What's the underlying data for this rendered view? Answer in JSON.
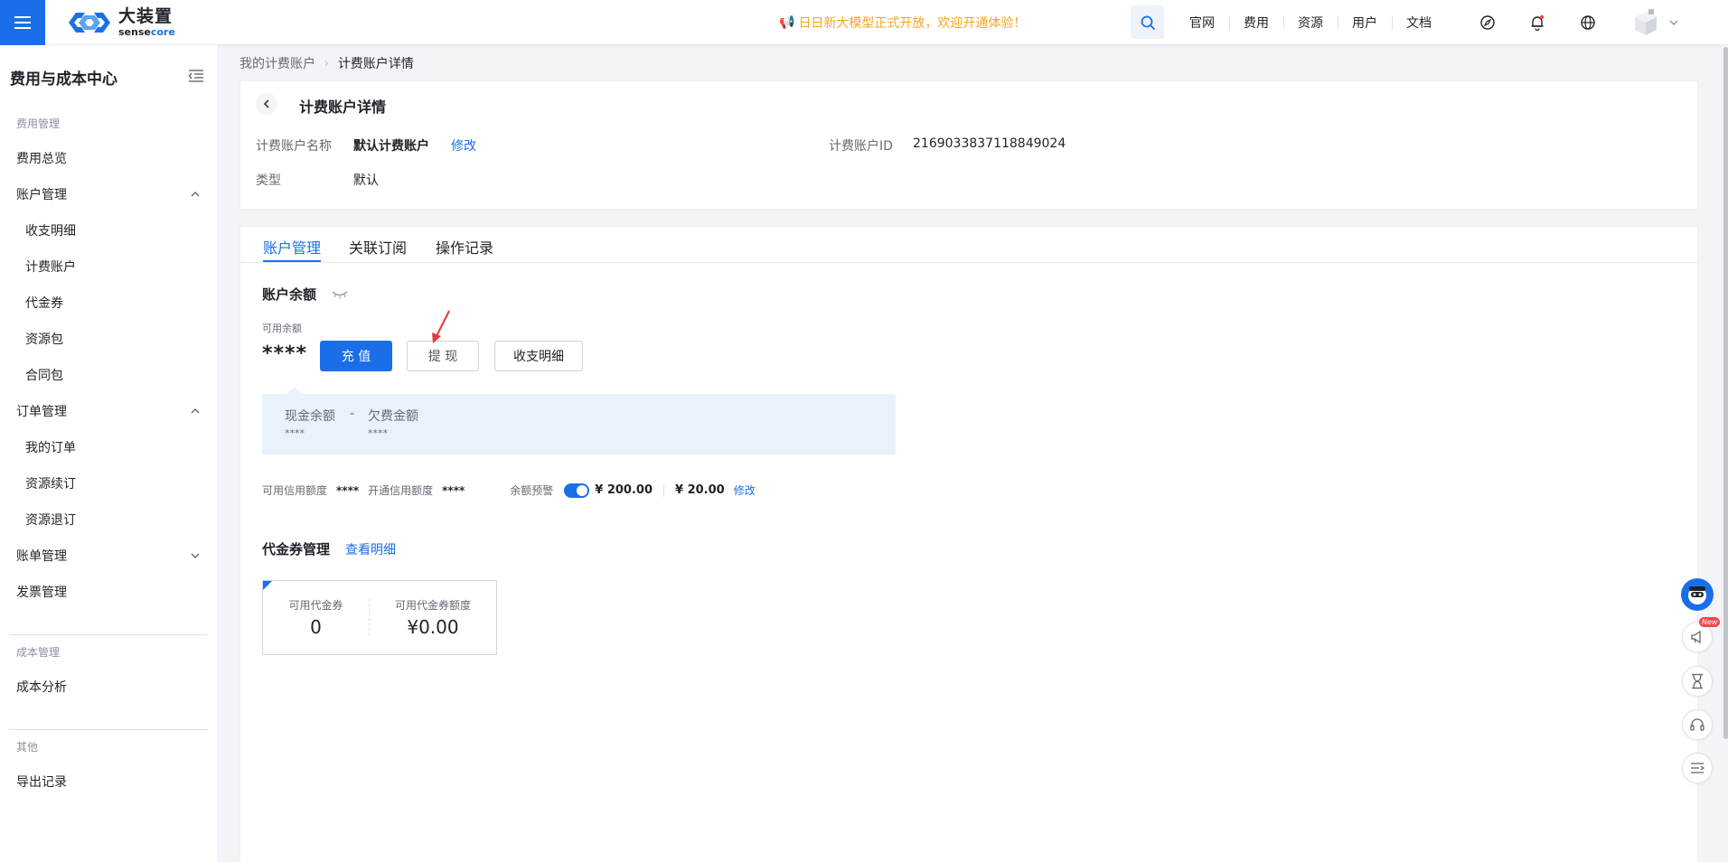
{
  "topbar": {
    "logo_title": "大装置",
    "logo_sub_a": "sense",
    "logo_sub_b": "core",
    "notice": "日日新大模型正式开放，欢迎开通体验！",
    "nav": [
      "官网",
      "费用",
      "资源",
      "用户",
      "文档"
    ],
    "icons": [
      "menu-icon",
      "search-icon",
      "compass-icon",
      "bell-icon",
      "globe-icon",
      "avatar",
      "chevron-down-icon"
    ]
  },
  "sidebar": {
    "title": "费用与成本中心",
    "group_fee": "费用管理",
    "item_overview": "费用总览",
    "item_account_mgmt": "账户管理",
    "sub_income": "收支明细",
    "sub_billing_account": "计费账户",
    "sub_voucher": "代金券",
    "sub_resource_pack": "资源包",
    "sub_contract_pack": "合同包",
    "item_order_mgmt": "订单管理",
    "sub_my_orders": "我的订单",
    "sub_renew": "资源续订",
    "sub_unsubscribe": "资源退订",
    "item_bill_mgmt": "账单管理",
    "item_invoice": "发票管理",
    "group_cost": "成本管理",
    "item_cost_analysis": "成本分析",
    "group_other": "其他",
    "item_export": "导出记录"
  },
  "breadcrumb": {
    "parent": "我的计费账户",
    "current": "计费账户详情"
  },
  "detail": {
    "title": "计费账户详情",
    "name_label": "计费账户名称",
    "name_value": "默认计费账户",
    "edit": "修改",
    "type_label": "类型",
    "type_value": "默认",
    "id_label": "计费账户ID",
    "id_value": "2169033837118849024"
  },
  "tabs": [
    "账户管理",
    "关联订阅",
    "操作记录"
  ],
  "balance": {
    "section_title": "账户余额",
    "available_label": "可用余额",
    "available_value": "****",
    "recharge": "充 值",
    "withdraw": "提 现",
    "details": "收支明细",
    "cash_label": "现金余额",
    "dash": "-",
    "arrears_label": "欠费金额",
    "cash_value": "****",
    "arrears_value": "****",
    "credit_available_label": "可用信用额度",
    "credit_available_value": "****",
    "credit_open_label": "开通信用额度",
    "credit_open_value": "****",
    "alert_label": "余额预警",
    "alert_amount": "¥ 200.00",
    "alert_amount2": "¥ 20.00",
    "alert_edit": "修改"
  },
  "voucher": {
    "section_title": "代金券管理",
    "view_details": "查看明细",
    "count_label": "可用代金券",
    "count_value": "0",
    "amount_label": "可用代金券额度",
    "amount_value": "¥0.00"
  },
  "colors": {
    "primary": "#1a6fe8",
    "notice": "#f5a623",
    "annotation": "#e53935"
  }
}
